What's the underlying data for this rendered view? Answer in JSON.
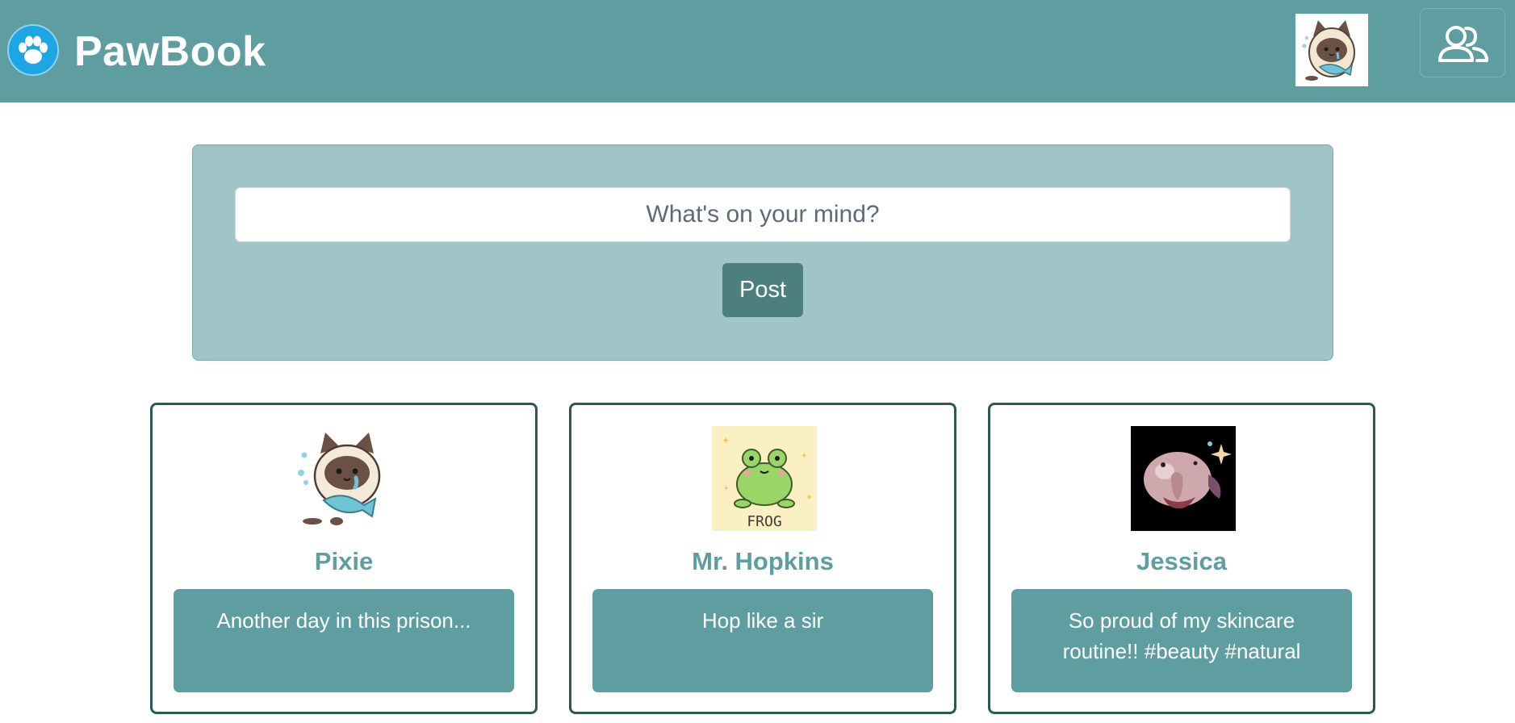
{
  "app": {
    "brand_name": "PawBook",
    "brand_icon": "paw-icon",
    "friends_icon": "users-icon"
  },
  "composer": {
    "placeholder": "What's on your mind?",
    "post_label": "Post"
  },
  "posts": [
    {
      "author": "Pixie",
      "text": "Another day in this prison...",
      "avatar": "cat-holding-fish-avatar"
    },
    {
      "author": "Mr. Hopkins",
      "text": "Hop like a sir",
      "avatar": "frog-avatar",
      "avatar_caption": "FROG"
    },
    {
      "author": "Jessica",
      "text": "So proud of my skincare routine!! #beauty #natural",
      "avatar": "blobfish-avatar"
    }
  ],
  "colors": {
    "navbar": "#5f9ea0",
    "composer_bg": "#a0c5c6",
    "post_button": "#4e7f7f",
    "card_border": "#2f5758",
    "card_body": "#5f9ea0"
  }
}
